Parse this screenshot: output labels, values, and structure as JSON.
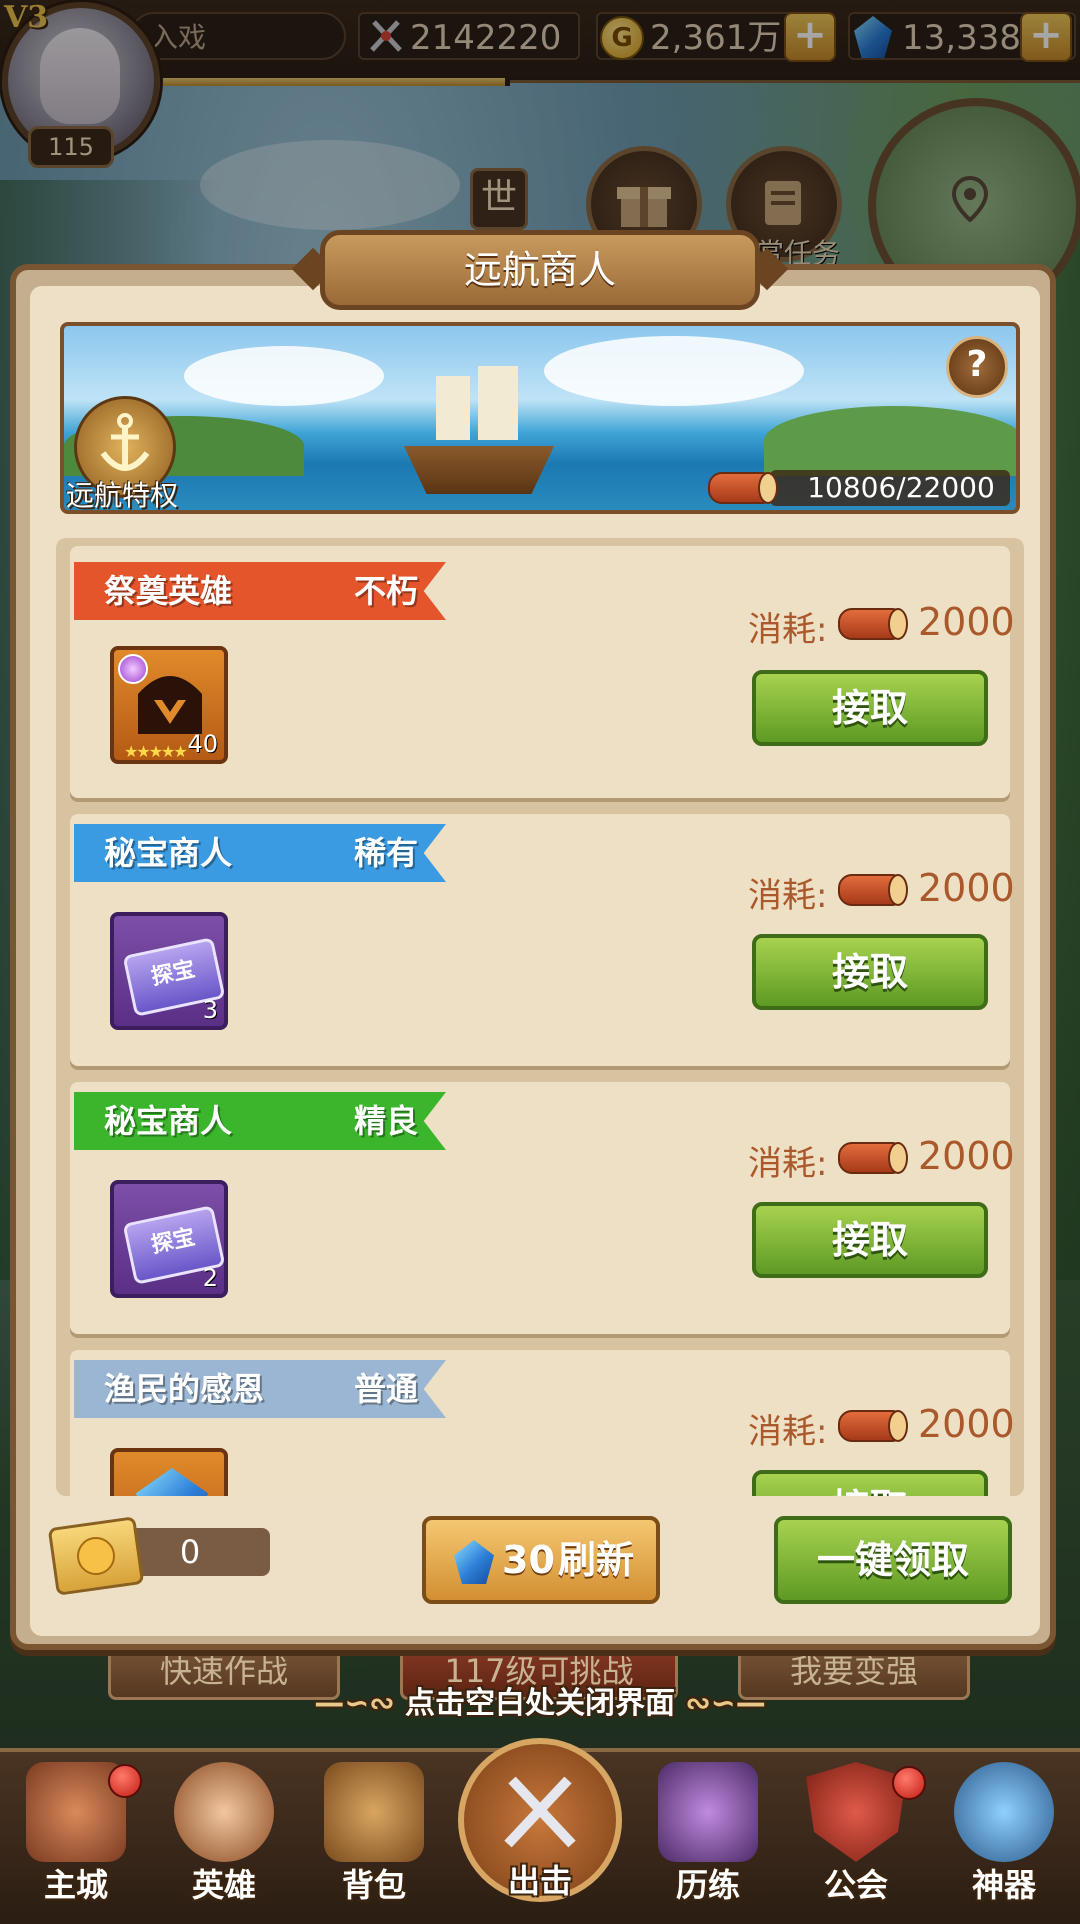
{
  "top_bar": {
    "vip": "V3",
    "level": "115",
    "player_name": "入戏",
    "power": "2142220",
    "gold": "2,361万",
    "gems": "13,338",
    "world_button": "世",
    "task_label": "赏任务"
  },
  "dialog": {
    "title": "远航商人",
    "privilege_label": "远航特权",
    "progress_text": "10806/22000",
    "cost_label": "消耗:",
    "accept_label": "接取",
    "tasks": [
      {
        "name": "祭奠英雄",
        "rarity": "不朽",
        "cost": "2000",
        "item_level": "40",
        "color": "#e4552b"
      },
      {
        "name": "秘宝商人",
        "rarity": "稀有",
        "cost": "2000",
        "item_text": "探宝",
        "item_count": "3",
        "color": "#3a9be2"
      },
      {
        "name": "秘宝商人",
        "rarity": "精良",
        "cost": "2000",
        "item_text": "探宝",
        "item_count": "2",
        "color": "#3bb52b"
      },
      {
        "name": "渔民的感恩",
        "rarity": "普通",
        "cost": "2000",
        "color": "#9ab6d3"
      }
    ],
    "ticket_count": "0",
    "refresh_cost": "30",
    "refresh_label": "刷新",
    "collect_all_label": "一键领取"
  },
  "behind": {
    "quick_battle": "快速作战",
    "level_challenge": "117级可挑战",
    "get_stronger": "我要变强"
  },
  "close_hint": "点击空白处关闭界面",
  "bottom_nav": [
    {
      "label": "主城"
    },
    {
      "label": "英雄"
    },
    {
      "label": "背包"
    },
    {
      "label": "出击"
    },
    {
      "label": "历练"
    },
    {
      "label": "公会"
    },
    {
      "label": "神器"
    }
  ]
}
